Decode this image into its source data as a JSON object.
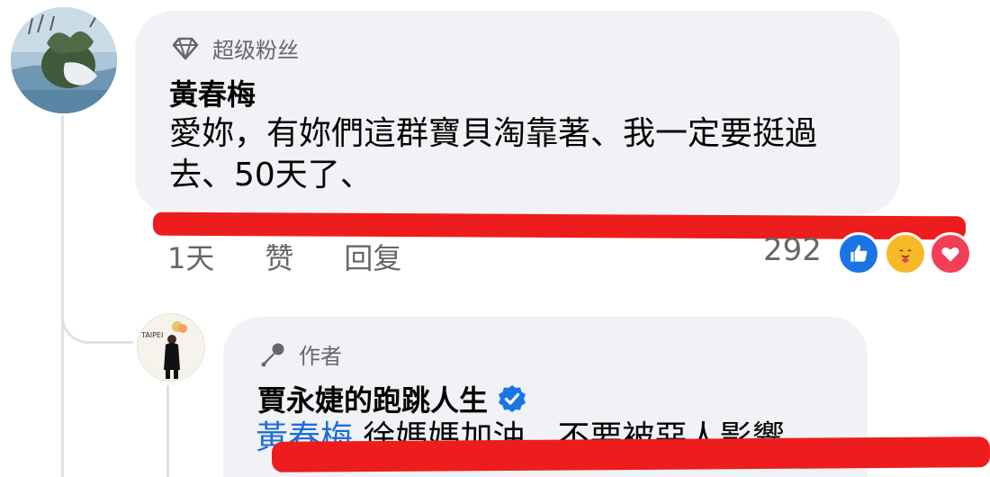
{
  "main_comment": {
    "badge": "超级粉丝",
    "badge_icon": "diamond-icon",
    "author": "黃春梅",
    "text": "愛妳，有妳們這群寶貝淘靠著、我一定要挺過去、50天了、",
    "actions": {
      "time": "1天",
      "like": "赞",
      "reply": "回复"
    },
    "reaction_count": "292",
    "reactions": [
      "like-reaction-icon",
      "care-reaction-icon",
      "love-reaction-icon"
    ]
  },
  "reply_comment": {
    "badge": "作者",
    "badge_icon": "microphone-icon",
    "author": "賈永婕的跑跳人生",
    "verified": true,
    "mention": "黃春梅",
    "text": " 徐媽媽加油，不要被惡人影響"
  },
  "colors": {
    "bubble": "#f0f2f5",
    "secondary_text": "#65676b",
    "mention": "#1c6fd6",
    "verified": "#1b74e4",
    "marker": "#ee1d1d"
  }
}
